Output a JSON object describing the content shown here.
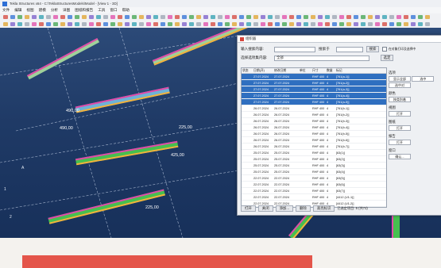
{
  "window": {
    "title": "Tekla Structures x64 - C:\\TeklaStructuresModels\\Model - [View 1 - 3D]"
  },
  "menu": [
    "文件",
    "编辑",
    "视图",
    "建模",
    "分析",
    "详图",
    "图纸和报告",
    "工具",
    "窗口",
    "帮助"
  ],
  "dialog": {
    "title": "组织器",
    "search_label": "输入搜索内容:",
    "search_value": "",
    "filter_label": "搜索于",
    "filter_value": "",
    "search_button": "搜索",
    "category_label": "选择选项集内容:",
    "category_value": "全部",
    "apply_button": "选定",
    "option_checkbox": "在对象打印及选择中",
    "columns": [
      "状态",
      "日期(开)",
      "修改日期",
      "单位",
      "尺寸",
      "数量",
      "标记"
    ],
    "rows": [
      {
        "c": [
          "",
          "27.07.2024",
          "27.07.2024",
          "",
          "RHF 400",
          "4",
          "[761(a-1)]"
        ],
        "sel": true
      },
      {
        "c": [
          "",
          "27.07.2024",
          "27.07.2024",
          "",
          "RHF 400",
          "4",
          "[761(a-2)]"
        ],
        "sel": true
      },
      {
        "c": [
          "",
          "27.07.2024",
          "27.07.2024",
          "",
          "RHF 400",
          "4",
          "[761(a-3)]"
        ],
        "sel": true
      },
      {
        "c": [
          "",
          "27.07.2024",
          "27.07.2024",
          "",
          "RHF 400",
          "4",
          "[761(a-4)]"
        ],
        "sel": true
      },
      {
        "c": [
          "",
          "27.07.2024",
          "27.07.2024",
          "",
          "RHF 400",
          "4",
          "[761(a-5)]"
        ],
        "sel": true
      },
      {
        "c": [
          "",
          "26.07.2024",
          "26.07.2024",
          "",
          "RHF 400",
          "4",
          "[761(b-1)]"
        ],
        "sel": false
      },
      {
        "c": [
          "",
          "26.07.2024",
          "26.07.2024",
          "",
          "RHF 400",
          "4",
          "[761(b-2)]"
        ],
        "sel": false
      },
      {
        "c": [
          "",
          "26.07.2024",
          "26.07.2024",
          "",
          "RHF 400",
          "4",
          "[761(b-3)]"
        ],
        "sel": false
      },
      {
        "c": [
          "",
          "26.07.2024",
          "26.07.2024",
          "",
          "RHF 400",
          "4",
          "[761(b-4)]"
        ],
        "sel": false
      },
      {
        "c": [
          "",
          "26.07.2024",
          "26.07.2024",
          "",
          "RHF 400",
          "4",
          "[761(b-5)]"
        ],
        "sel": false
      },
      {
        "c": [
          "",
          "26.07.2024",
          "26.07.2024",
          "",
          "RHF 400",
          "4",
          "[761(b-6)]"
        ],
        "sel": false
      },
      {
        "c": [
          "",
          "26.07.2024",
          "26.07.2024",
          "",
          "RHF 400",
          "4",
          "[761(b-7)]"
        ],
        "sel": false
      },
      {
        "c": [
          "",
          "25.07.2024",
          "25.07.2024",
          "",
          "RHF 400",
          "4",
          "[63(1)]"
        ],
        "sel": false
      },
      {
        "c": [
          "",
          "25.07.2024",
          "25.07.2024",
          "",
          "RHF 400",
          "4",
          "[63(2)]"
        ],
        "sel": false
      },
      {
        "c": [
          "",
          "25.07.2024",
          "25.07.2024",
          "",
          "RHF 400",
          "4",
          "[63(3)]"
        ],
        "sel": false
      },
      {
        "c": [
          "",
          "25.07.2024",
          "25.07.2024",
          "",
          "RHF 400",
          "4",
          "[63(4)]"
        ],
        "sel": false
      },
      {
        "c": [
          "",
          "22.07.2024",
          "22.07.2024",
          "",
          "RHF 400",
          "4",
          "[63(5)]"
        ],
        "sel": false
      },
      {
        "c": [
          "",
          "22.07.2024",
          "22.07.2024",
          "",
          "RHF 400",
          "4",
          "[63(6)]"
        ],
        "sel": false
      },
      {
        "c": [
          "",
          "22.07.2024",
          "22.07.2024",
          "",
          "RHF 400",
          "4",
          "[63(7)]"
        ],
        "sel": false
      },
      {
        "c": [
          "",
          "22.07.2024",
          "22.07.2024",
          "",
          "RHF 400",
          "4",
          "[4412 (U1-1)]"
        ],
        "sel": false
      },
      {
        "c": [
          "",
          "22.07.2024",
          "22.07.2024",
          "",
          "RHF 400",
          "4",
          "[4412 (U1-2)]"
        ],
        "sel": false
      },
      {
        "c": [
          "",
          "22.07.2024",
          "22.07.2024",
          "",
          "RHF 400",
          "4",
          "[4412 (U1-3)]"
        ],
        "sel": false
      }
    ],
    "right_panel": {
      "g1": "选项",
      "b1": "显示全部",
      "b2": "选中",
      "b3": "选中对",
      "g2": "颜色",
      "b4": "按类别着",
      "g3": "视图",
      "b5": "打开",
      "g4": "图纸",
      "b6": "打开",
      "g5": "报告",
      "b7": "打开",
      "g6": "窗口",
      "b8": "确认..."
    },
    "footer": {
      "btn1": "打开",
      "btn2": "关闭",
      "btn3": "添加...",
      "btn4": "删除",
      "btn5": "高亮标识",
      "status": "已选定项目: 5 (共72)"
    }
  },
  "model": {
    "dims": [
      "490,00",
      "225,00",
      "490,00",
      "425,00",
      "225,00"
    ],
    "grid_labels": [
      "A",
      "1",
      "2"
    ]
  },
  "colors": {
    "selection": "#2f6fc0",
    "viewport": "#203a63",
    "beam_green": "#3fbf4a",
    "beam_pink": "#e04aa8",
    "red_bar": "#e4554a"
  }
}
